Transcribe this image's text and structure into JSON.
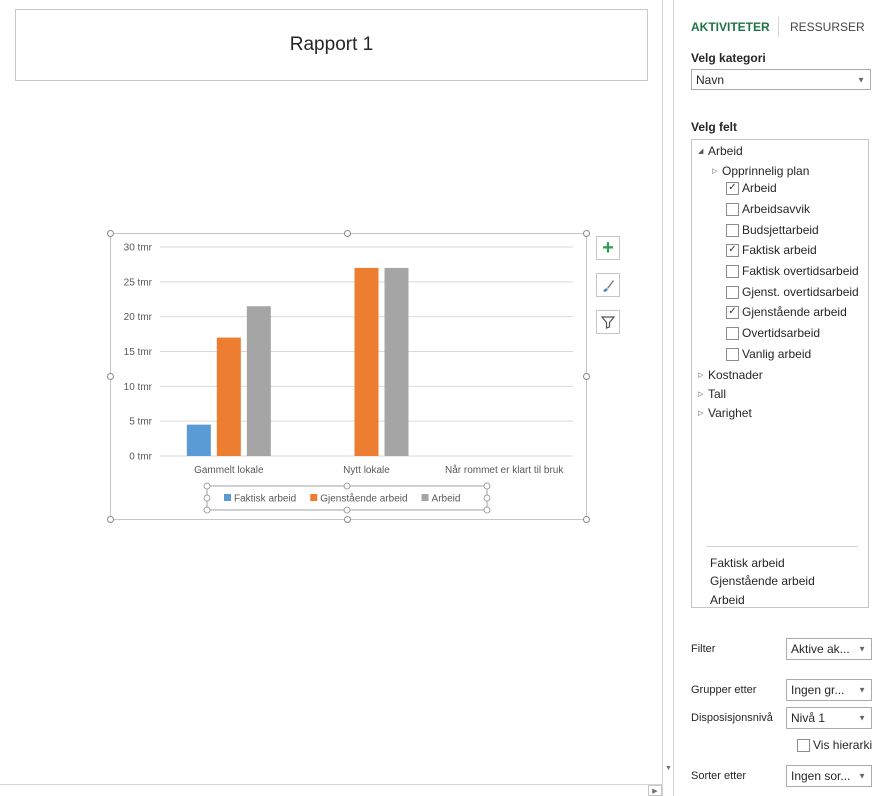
{
  "report": {
    "title": "Rapport 1"
  },
  "chart_data": {
    "type": "bar",
    "categories": [
      "Gammelt lokale",
      "Nytt lokale",
      "Når rommet er klart til bruk"
    ],
    "series": [
      {
        "name": "Faktisk arbeid",
        "color": "#5B9BD5",
        "values": [
          4.5,
          0,
          0
        ]
      },
      {
        "name": "Gjenstående arbeid",
        "color": "#ED7D31",
        "values": [
          17,
          27,
          0
        ]
      },
      {
        "name": "Arbeid",
        "color": "#A5A5A5",
        "values": [
          21.5,
          27,
          0
        ]
      }
    ],
    "y_ticks": [
      "0 tmr",
      "5 tmr",
      "10 tmr",
      "15 tmr",
      "20 tmr",
      "25 tmr",
      "30 tmr"
    ],
    "ylim": [
      0,
      30
    ],
    "grid": true,
    "legend": "bottom"
  },
  "chart_buttons": {
    "add_icon": "plus-icon",
    "style_icon": "brush-icon",
    "filter_icon": "filter-icon"
  },
  "pane": {
    "tabs": [
      {
        "label": "AKTIVITETER",
        "active": true
      },
      {
        "label": "RESSURSER",
        "active": false
      }
    ],
    "category": {
      "label": "Velg kategori",
      "value": "Navn"
    },
    "fields": {
      "label": "Velg felt",
      "tree": [
        {
          "label": "Arbeid",
          "kind": "group-open"
        },
        {
          "label": "Opprinnelig plan",
          "kind": "group-closed"
        },
        {
          "label": "Arbeid",
          "checked": true
        },
        {
          "label": "Arbeidsavvik",
          "checked": false
        },
        {
          "label": "Budsjettarbeid",
          "checked": false
        },
        {
          "label": "Faktisk arbeid",
          "checked": true
        },
        {
          "label": "Faktisk overtidsarbeid",
          "checked": false
        },
        {
          "label": "Gjenst. overtidsarbeid",
          "checked": false
        },
        {
          "label": "Gjenstående arbeid",
          "checked": true
        },
        {
          "label": "Overtidsarbeid",
          "checked": false
        },
        {
          "label": "Vanlig arbeid",
          "checked": false
        },
        {
          "label": "Kostnader",
          "kind": "group-closed"
        },
        {
          "label": "Tall",
          "kind": "group-closed"
        },
        {
          "label": "Varighet",
          "kind": "group-closed"
        }
      ],
      "selected": [
        "Faktisk arbeid",
        "Gjenstående arbeid",
        "Arbeid"
      ]
    },
    "filter": {
      "label": "Filter",
      "value": "Aktive ak..."
    },
    "group_by": {
      "label": "Grupper etter",
      "value": "Ingen gr..."
    },
    "outline_level": {
      "label": "Disposisjonsnivå",
      "value": "Nivå 1"
    },
    "show_hierarchy": {
      "label": "Vis hierarki",
      "checked": false
    },
    "sort_by": {
      "label": "Sorter etter",
      "value": "Ingen sor..."
    }
  }
}
